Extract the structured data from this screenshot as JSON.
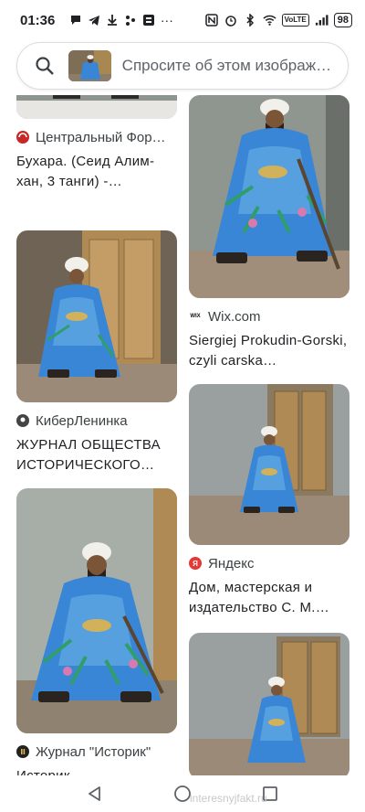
{
  "status_bar": {
    "time": "01:36",
    "network": "VoLTE",
    "battery": "98"
  },
  "search": {
    "placeholder": "Спросите об этом изображении"
  },
  "results": [
    {
      "source": "Центральный Фор…",
      "title": "Бухара. (Сеид Алим-хан, 3 танги) -…",
      "favicon_color": "#c62828"
    },
    {
      "source": "Wix.com",
      "title": "Siergiej Prokudin-Gorski, czyli carska…",
      "favicon_color": "#111111",
      "favicon_text": "WIX"
    },
    {
      "source": "КиберЛенинка",
      "title": "ЖУРНАЛ ОБЩЕСТВА ИСТОРИЧЕСКОГО…",
      "favicon_color": "#444444"
    },
    {
      "source": "Яндекс",
      "title": "Дом, мастерская и издательство С. М.…",
      "favicon_color": "#e53935",
      "favicon_text": "Я"
    },
    {
      "source": "Журнал \"Историк\"",
      "title": "Историк",
      "favicon_color": "#222222"
    }
  ],
  "watermark": "interesnyjfakt.ru",
  "colors": {
    "robe_blue": "#3a86d6",
    "robe_light": "#6fb6e8",
    "turban": "#f2f0ea",
    "door_wood": "#b08a55",
    "wall_gray": "#9aa0a0",
    "ground": "#9b8a78"
  }
}
